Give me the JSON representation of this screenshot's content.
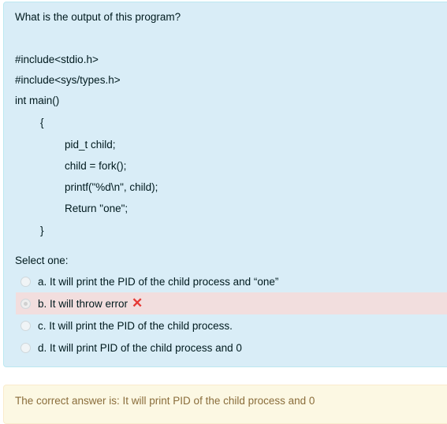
{
  "question": {
    "title": "What is the output of this program?",
    "code": [
      "#include<stdio.h>",
      "#include<sys/types.h>",
      "int main()",
      "{",
      "pid_t child;",
      "child = fork();",
      "printf(\"%d\\n\", child);",
      "Return \"one\";",
      "}"
    ],
    "prompt": "Select one:",
    "options": [
      {
        "label": "a. It will print the PID of the child process and “one”",
        "selected": false
      },
      {
        "label": "b. It will throw error",
        "selected": true,
        "status": "incorrect"
      },
      {
        "label": "c. It will print the PID of the child process.",
        "selected": false
      },
      {
        "label": "d. It will print PID of the child process and 0",
        "selected": false
      }
    ],
    "incorrect_icon": "cross-icon"
  },
  "feedback": {
    "text": "The correct answer is: It will print PID of the child process and 0"
  },
  "colors": {
    "question_bg": "#d9edf7",
    "wrong_bg": "#f2dede",
    "feedback_bg": "#fcf8e3",
    "cross": "#e53935"
  }
}
